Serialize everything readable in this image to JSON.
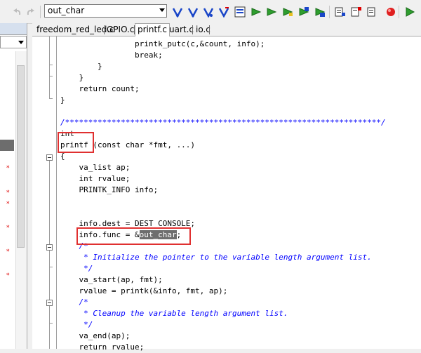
{
  "toolbar": {
    "find_value": "out_char",
    "icons": [
      "undo-icon",
      "redo-icon",
      "find-icon",
      "find-next-icon",
      "find-prev-icon",
      "toggle-bookmark-icon",
      "bookmarks-icon",
      "next-bookmark-icon",
      "prev-bookmark-icon",
      "goto-icon",
      "build-icon",
      "rebuild-icon",
      "insert-breakpoint-icon",
      "enable-breakpoint-icon",
      "disable-breakpoint-icon",
      "kill-breakpoints-icon",
      "run-icon"
    ],
    "accent": "#1a46c8"
  },
  "tabs": [
    {
      "label": "freedom_red_led.c",
      "active": false
    },
    {
      "label": "GPIO.c",
      "active": false
    },
    {
      "label": "printf.c",
      "active": true
    },
    {
      "label": "uart.c",
      "active": false
    },
    {
      "label": "io.c",
      "active": false
    }
  ],
  "code": [
    {
      "text": "                printk_putc(c,&count, info);",
      "kind": "code"
    },
    {
      "text": "                break;",
      "kind": "code"
    },
    {
      "text": "        }",
      "kind": "code"
    },
    {
      "text": "    }",
      "kind": "code"
    },
    {
      "text": "    return count;",
      "kind": "code"
    },
    {
      "text": "}",
      "kind": "code"
    },
    {
      "text": "",
      "kind": "code"
    },
    {
      "text": "/********************************************************************/",
      "kind": "comment"
    },
    {
      "text": "int",
      "kind": "code"
    },
    {
      "text": "printf (const char *fmt, ...)",
      "kind": "code"
    },
    {
      "text": "{",
      "kind": "code"
    },
    {
      "text": "    va_list ap;",
      "kind": "code"
    },
    {
      "text": "    int rvalue;",
      "kind": "code"
    },
    {
      "text": "    PRINTK_INFO info;",
      "kind": "code"
    },
    {
      "text": "",
      "kind": "code"
    },
    {
      "text": "",
      "kind": "code"
    },
    {
      "text": "    info.dest = DEST_CONSOLE;",
      "kind": "code"
    },
    {
      "text": "    info.func = &",
      "kind": "code",
      "highlight": "out_char",
      "after": ";"
    },
    {
      "text": "    /*",
      "kind": "comment"
    },
    {
      "text": "     * Initialize the pointer to the variable length argument list.",
      "kind": "comment"
    },
    {
      "text": "     */",
      "kind": "comment"
    },
    {
      "text": "    va_start(ap, fmt);",
      "kind": "code"
    },
    {
      "text": "    rvalue = printk(&info, fmt, ap);",
      "kind": "code"
    },
    {
      "text": "    /*",
      "kind": "comment"
    },
    {
      "text": "     * Cleanup the variable length argument list.",
      "kind": "comment"
    },
    {
      "text": "     */",
      "kind": "comment"
    },
    {
      "text": "    va_end(ap);",
      "kind": "code"
    },
    {
      "text": "    return rvalue;",
      "kind": "code"
    }
  ],
  "colors": {
    "comment": "#0000ff",
    "highlight_box": "#e03030"
  }
}
